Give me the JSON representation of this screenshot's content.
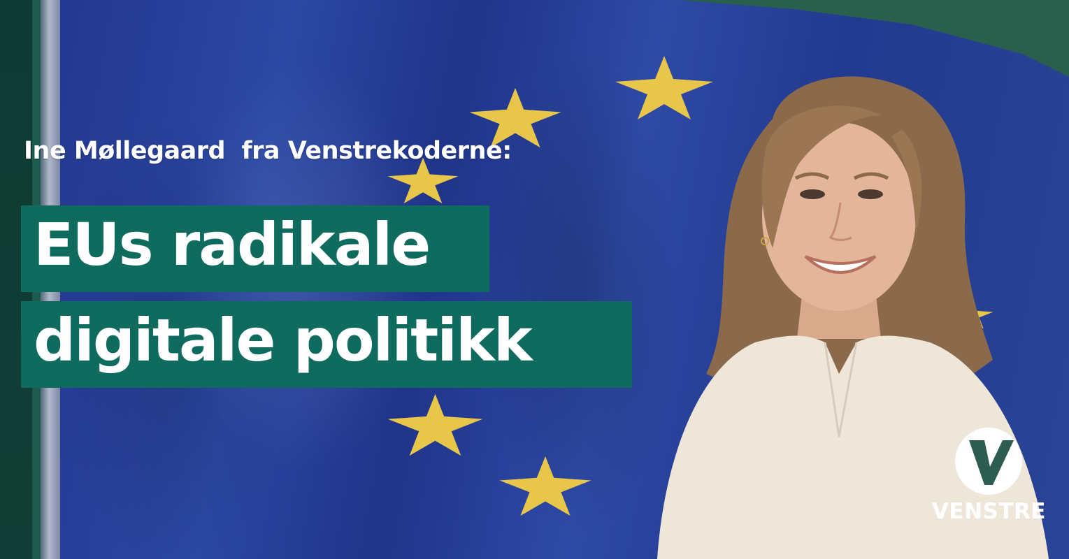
{
  "subtitle": "Ine Møllegaard  fra Venstrekoderne:",
  "headline": {
    "line1": "EUs radikale",
    "line2": "digitale politikk"
  },
  "logo": {
    "wordmark": "VENSTRE",
    "icon": "venstre-v-icon"
  },
  "colors": {
    "flag_blue": "#2b48a4",
    "star_yellow": "#e8c64a",
    "headline_box": "#0e6b5e",
    "frame_green": "#0e3a31"
  }
}
